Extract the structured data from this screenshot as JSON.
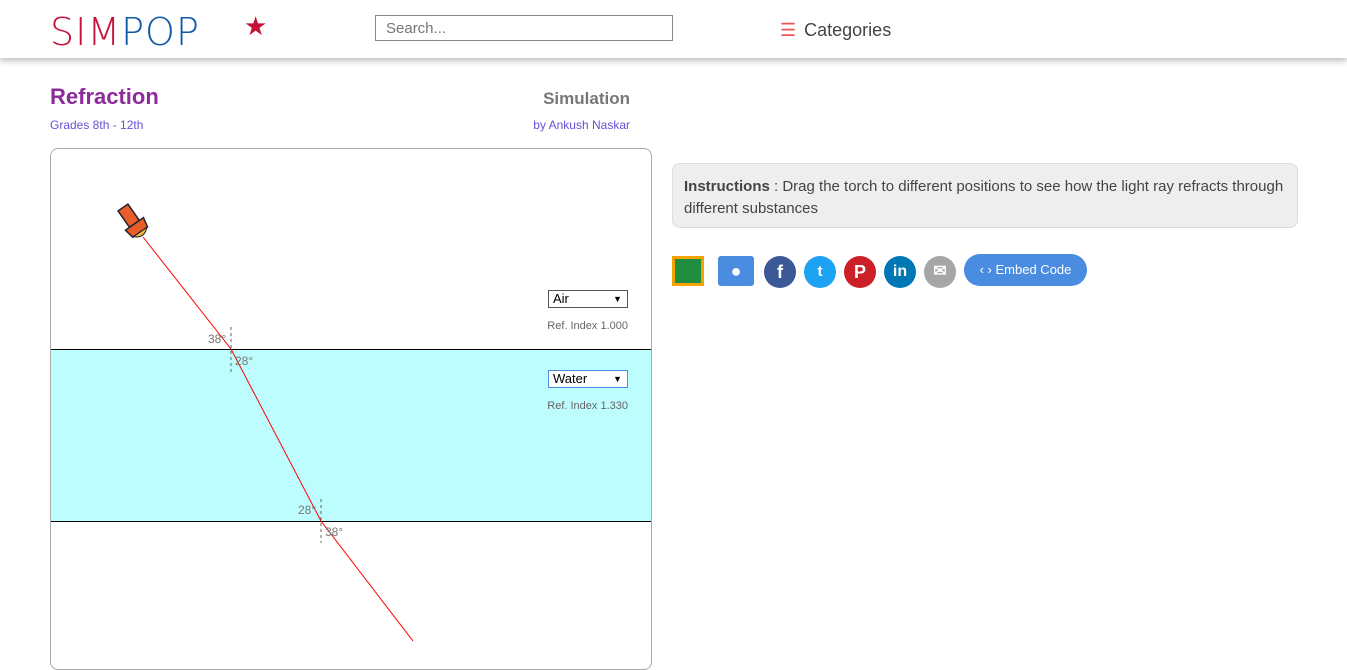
{
  "header": {
    "logo_left": "SIM",
    "logo_right": "POP",
    "search_placeholder": "Search...",
    "categories_icon": "hamburger-icon",
    "categories_label": "Categories",
    "categories_glyph": "☰"
  },
  "page": {
    "title": "Refraction",
    "grades": "Grades 8th - 12th",
    "type": "Simulation",
    "author": "by Ankush Naskar"
  },
  "sim": {
    "top_medium": "Air",
    "top_index": "Ref. Index 1.000",
    "bottom_medium": "Water",
    "bottom_index": "Ref. Index 1.330",
    "angles": {
      "a1": "38°",
      "a2": "28°",
      "a3": "28°",
      "a4": "38°"
    },
    "colors": {
      "water": "#bdfdfd",
      "ray": "#ff0000"
    }
  },
  "instructions": {
    "label": "Instructions",
    "text": " : Drag the torch to different positions to see how the light ray refracts through different substances"
  },
  "share": {
    "embed_label": "Embed Code",
    "icons": [
      "google-classroom-icon",
      "chat-icon",
      "facebook-icon",
      "twitter-icon",
      "pinterest-icon",
      "linkedin-icon",
      "email-icon"
    ]
  }
}
